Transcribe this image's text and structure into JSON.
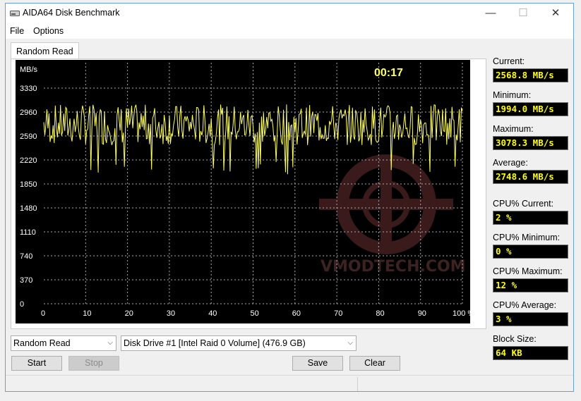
{
  "window": {
    "title": "AIDA64 Disk Benchmark",
    "minimize": "—",
    "maximize": "☐",
    "close": "✕"
  },
  "menu": {
    "file": "File",
    "options": "Options"
  },
  "tab": {
    "label": "Random Read"
  },
  "chart_data": {
    "type": "line",
    "ylabel": "MB/s",
    "timer": "00:17",
    "yticks": [
      "3330",
      "2960",
      "2590",
      "2220",
      "1850",
      "1480",
      "1110",
      "740",
      "370",
      "0"
    ],
    "xticks": [
      "0",
      "10",
      "20",
      "30",
      "40",
      "50",
      "60",
      "70",
      "80",
      "90",
      "100 %"
    ],
    "ylim": [
      0,
      3330
    ],
    "xlim": [
      0,
      100
    ],
    "grid": true,
    "series_color": "#ffff66",
    "series": [
      {
        "x_range": [
          0,
          100
        ],
        "min": 1994.0,
        "max": 3078.3,
        "average": 2748.6,
        "current": 2568.8
      }
    ],
    "watermark": "VMODTECH.COM"
  },
  "stats": {
    "current_label": "Current:",
    "current_value": "2568.8 MB/s",
    "minimum_label": "Minimum:",
    "minimum_value": "1994.0 MB/s",
    "maximum_label": "Maximum:",
    "maximum_value": "3078.3 MB/s",
    "average_label": "Average:",
    "average_value": "2748.6 MB/s",
    "cpu_current_label": "CPU% Current:",
    "cpu_current_value": "2 %",
    "cpu_minimum_label": "CPU% Minimum:",
    "cpu_minimum_value": "0 %",
    "cpu_maximum_label": "CPU% Maximum:",
    "cpu_maximum_value": "12 %",
    "cpu_average_label": "CPU% Average:",
    "cpu_average_value": "3 %",
    "block_size_label": "Block Size:",
    "block_size_value": "64 KB"
  },
  "controls": {
    "test_select": "Random Read",
    "drive_select": "Disk Drive #1  [Intel   Raid 0 Volume]  (476.9 GB)",
    "start": "Start",
    "stop": "Stop",
    "save": "Save",
    "clear": "Clear"
  }
}
